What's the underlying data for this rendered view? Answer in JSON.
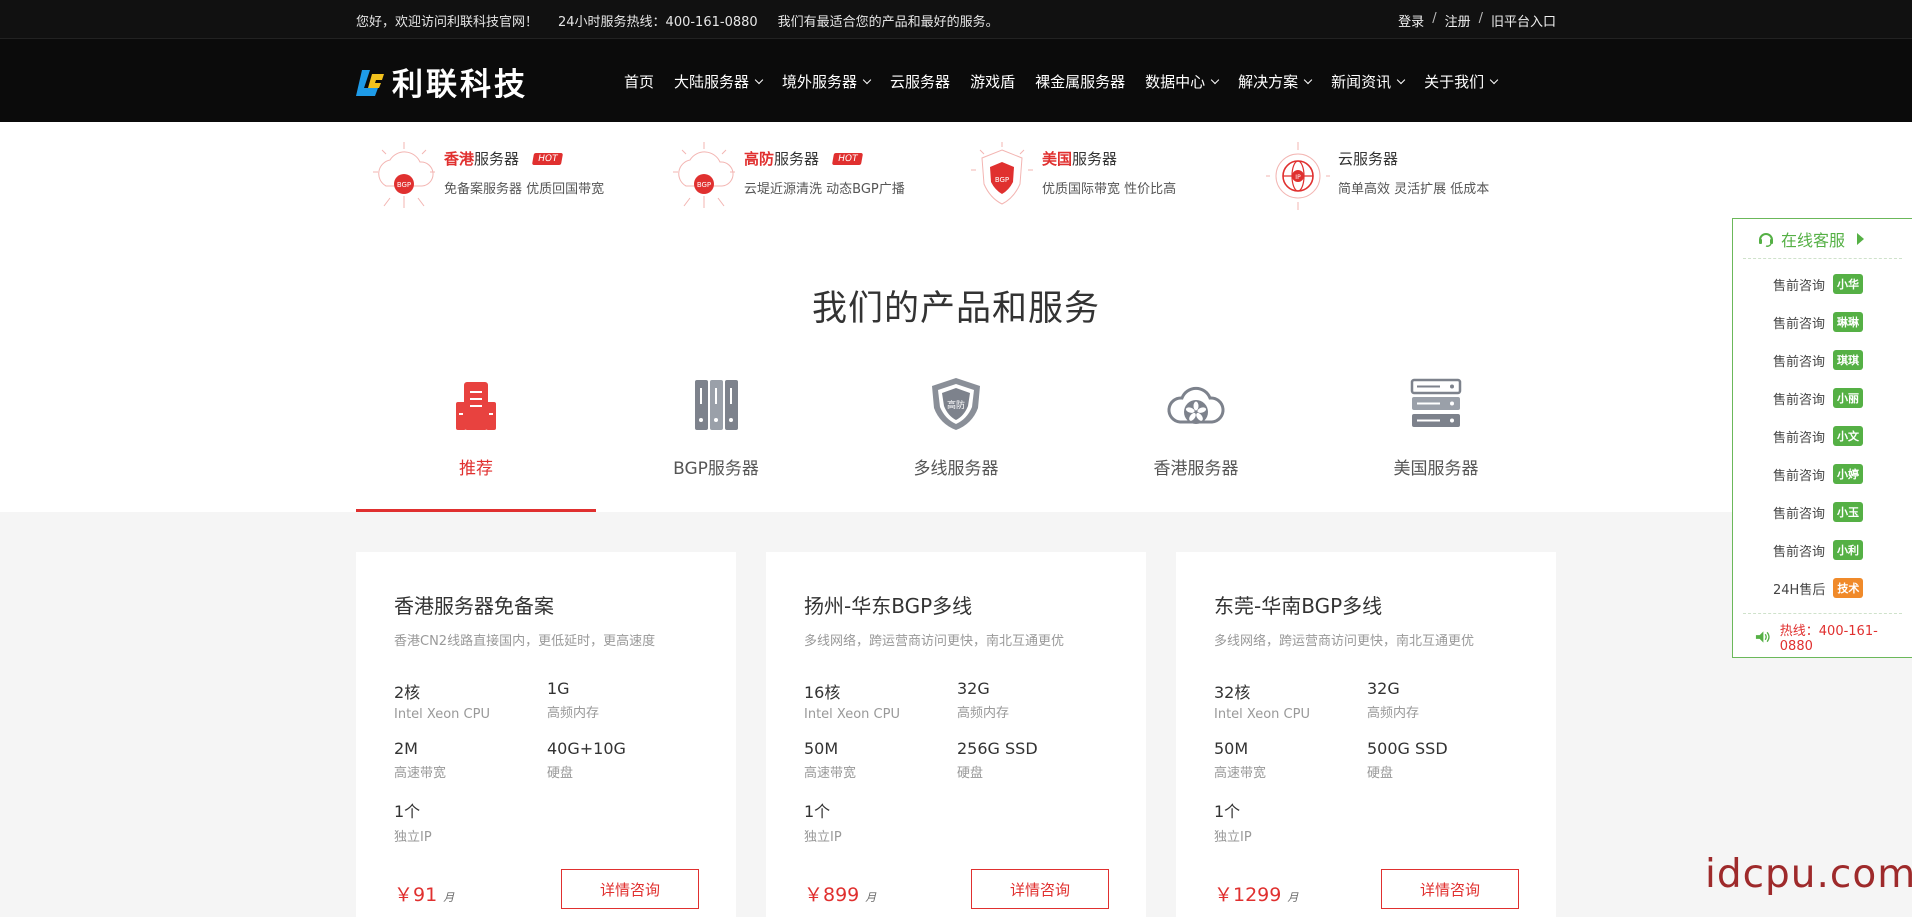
{
  "topbar": {
    "welcome": "您好，欢迎访问利联科技官网！",
    "hotline": "24小时服务热线：400-161-0880",
    "slogan": "我们有最适合您的产品和最好的服务。",
    "login": "登录",
    "register": "注册",
    "sep": "/",
    "old_platform": "旧平台入口"
  },
  "nav": {
    "logo_text": "利联科技",
    "items": [
      {
        "label": "首页",
        "dropdown": false
      },
      {
        "label": "大陆服务器",
        "dropdown": true
      },
      {
        "label": "境外服务器",
        "dropdown": true
      },
      {
        "label": "云服务器",
        "dropdown": false
      },
      {
        "label": "游戏盾",
        "dropdown": false
      },
      {
        "label": "裸金属服务器",
        "dropdown": false
      },
      {
        "label": "数据中心",
        "dropdown": true
      },
      {
        "label": "解决方案",
        "dropdown": true
      },
      {
        "label": "新闻资讯",
        "dropdown": true
      },
      {
        "label": "关于我们",
        "dropdown": true
      }
    ]
  },
  "features": [
    {
      "highlight": "香港",
      "title": "服务器",
      "hot": "HOT",
      "desc": "免备案服务器 优质回国带宽",
      "icon_text": "BGP"
    },
    {
      "highlight": "高防",
      "title": "服务器",
      "hot": "HOT",
      "desc": "云堤近源清洗 动态BGP广播",
      "icon_text": "BGP"
    },
    {
      "highlight": "美国",
      "title": "服务器",
      "hot": "",
      "desc": "优质国际带宽 性价比高",
      "icon_text": "BGP"
    },
    {
      "highlight": "",
      "title": "云服务器",
      "hot": "",
      "desc": "简单高效 灵活扩展 低成本",
      "icon_text": "IP"
    }
  ],
  "products": {
    "title": "我们的产品和服务",
    "tabs": [
      {
        "label": "推荐",
        "active": true
      },
      {
        "label": "BGP服务器",
        "active": false
      },
      {
        "label": "多线服务器",
        "active": false
      },
      {
        "label": "香港服务器",
        "active": false
      },
      {
        "label": "美国服务器",
        "active": false
      }
    ],
    "shield_text": "高防"
  },
  "cards": [
    {
      "title": "香港服务器免备案",
      "subtitle": "香港CN2线路直接国内，更低延时，更高速度",
      "specs": [
        {
          "value": "2核",
          "label": "Intel Xeon CPU"
        },
        {
          "value": "1G",
          "label": "高频内存"
        },
        {
          "value": "2M",
          "label": "高速带宽"
        },
        {
          "value": "40G+10G",
          "label": "硬盘"
        },
        {
          "value": "1个",
          "label": "独立IP"
        }
      ],
      "price": "￥91",
      "unit": "月",
      "button": "详情咨询"
    },
    {
      "title": "扬州-华东BGP多线",
      "subtitle": "多线网络，跨运营商访问更快，南北互通更优",
      "specs": [
        {
          "value": "16核",
          "label": "Intel Xeon CPU"
        },
        {
          "value": "32G",
          "label": "高频内存"
        },
        {
          "value": "50M",
          "label": "高速带宽"
        },
        {
          "value": "256G SSD",
          "label": "硬盘"
        },
        {
          "value": "1个",
          "label": "独立IP"
        }
      ],
      "price": "￥899",
      "unit": "月",
      "button": "详情咨询"
    },
    {
      "title": "东莞-华南BGP多线",
      "subtitle": "多线网络，跨运营商访问更快，南北互通更优",
      "specs": [
        {
          "value": "32核",
          "label": "Intel Xeon CPU"
        },
        {
          "value": "32G",
          "label": "高频内存"
        },
        {
          "value": "50M",
          "label": "高速带宽"
        },
        {
          "value": "500G SSD",
          "label": "硬盘"
        },
        {
          "value": "1个",
          "label": "独立IP"
        }
      ],
      "price": "￥1299",
      "unit": "月",
      "button": "详情咨询"
    }
  ],
  "service": {
    "title": "在线客服",
    "rows": [
      {
        "label": "售前咨询",
        "badge": "小华",
        "orange": false
      },
      {
        "label": "售前咨询",
        "badge": "琳琳",
        "orange": false
      },
      {
        "label": "售前咨询",
        "badge": "琪琪",
        "orange": false
      },
      {
        "label": "售前咨询",
        "badge": "小丽",
        "orange": false
      },
      {
        "label": "售前咨询",
        "badge": "小文",
        "orange": false
      },
      {
        "label": "售前咨询",
        "badge": "小婷",
        "orange": false
      },
      {
        "label": "售前咨询",
        "badge": "小玉",
        "orange": false
      },
      {
        "label": "售前咨询",
        "badge": "小利",
        "orange": false
      },
      {
        "label": "24H售后",
        "badge": "技术",
        "orange": true
      }
    ],
    "hotline": "热线：400-161-0880"
  },
  "watermark": "idcpu.com",
  "colors": {
    "accent": "#e0302f",
    "service_green": "#55b045",
    "nav_bg": "#0b0b0b"
  }
}
